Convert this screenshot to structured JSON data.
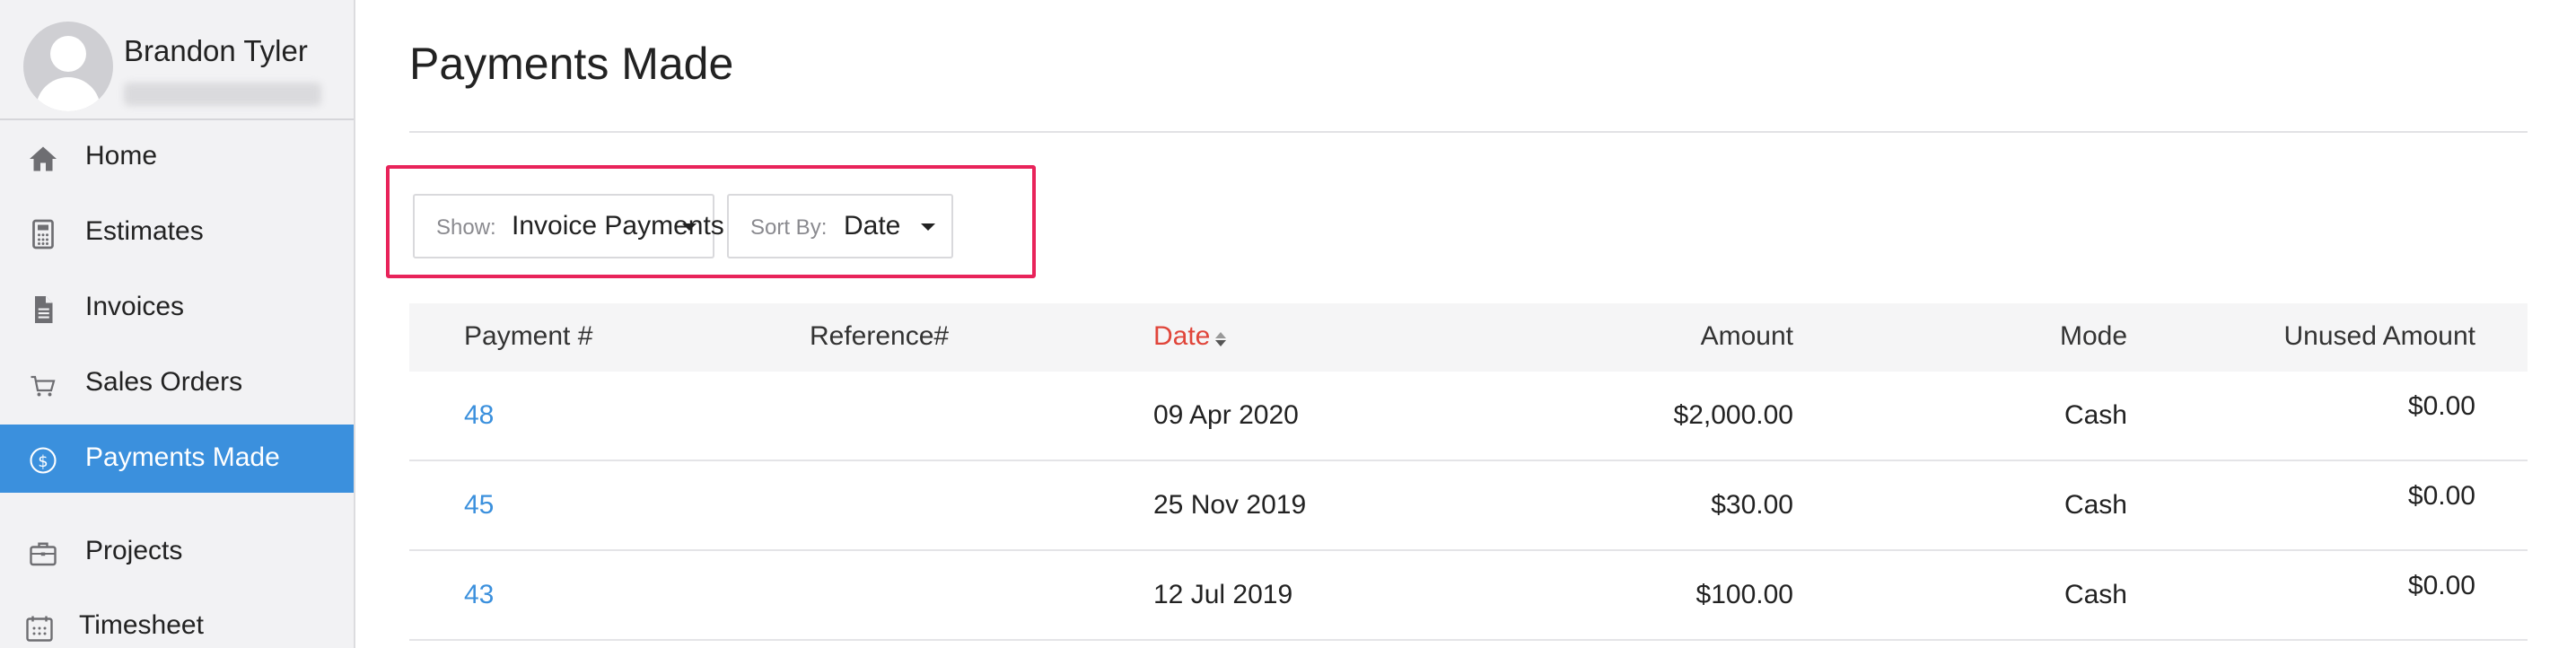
{
  "profile": {
    "name": "Brandon Tyler"
  },
  "sidebar": {
    "items": [
      {
        "label": "Home",
        "icon": "home-icon"
      },
      {
        "label": "Estimates",
        "icon": "calculator-icon"
      },
      {
        "label": "Invoices",
        "icon": "document-icon"
      },
      {
        "label": "Sales Orders",
        "icon": "cart-icon"
      },
      {
        "label": "Payments Made",
        "icon": "dollar-circle-icon",
        "active": true
      },
      {
        "label": "Projects",
        "icon": "briefcase-icon"
      },
      {
        "label": "Timesheet",
        "icon": "calendar-icon"
      }
    ]
  },
  "main": {
    "title": "Payments Made",
    "filters": {
      "show_label": "Show:",
      "show_value": "Invoice Payments",
      "sort_label": "Sort By:",
      "sort_value": "Date"
    },
    "table": {
      "columns": [
        "Payment #",
        "Reference#",
        "Date",
        "Amount",
        "Mode",
        "Unused Amount"
      ],
      "sorted_column": "Date",
      "rows": [
        {
          "payment": "48",
          "reference": "",
          "date": "09 Apr 2020",
          "amount": "$2,000.00",
          "mode": "Cash",
          "unused": "$0.00"
        },
        {
          "payment": "45",
          "reference": "",
          "date": "25 Nov 2019",
          "amount": "$30.00",
          "mode": "Cash",
          "unused": "$0.00"
        },
        {
          "payment": "43",
          "reference": "",
          "date": "12 Jul 2019",
          "amount": "$100.00",
          "mode": "Cash",
          "unused": "$0.00"
        }
      ]
    }
  },
  "colors": {
    "accent": "#3b90dd",
    "sorted_header": "#e0453a",
    "highlight": "#e8235a",
    "sidebar_bg": "#f2f2f4"
  }
}
